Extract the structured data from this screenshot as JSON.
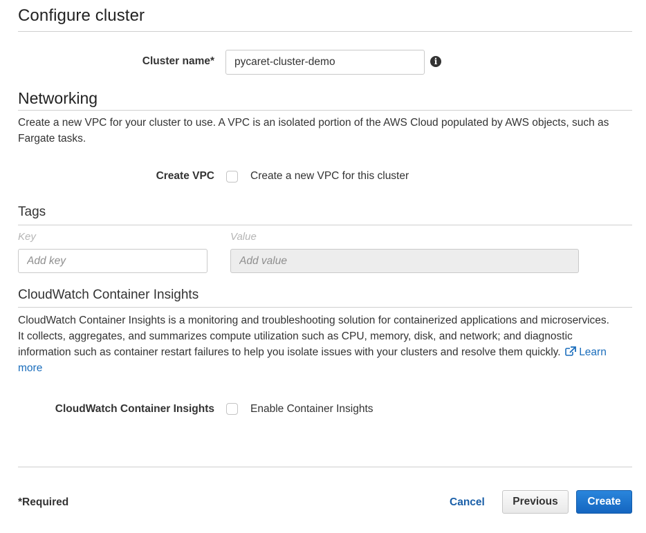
{
  "page": {
    "title": "Configure cluster"
  },
  "cluster_name": {
    "label": "Cluster name*",
    "value": "pycaret-cluster-demo",
    "info_icon": "info-icon"
  },
  "networking": {
    "heading": "Networking",
    "description": "Create a new VPC for your cluster to use. A VPC is an isolated portion of the AWS Cloud populated by AWS objects, such as Fargate tasks.",
    "create_vpc_label": "Create VPC",
    "create_vpc_checkbox_label": "Create a new VPC for this cluster",
    "create_vpc_checked": false
  },
  "tags": {
    "heading": "Tags",
    "key_column": "Key",
    "value_column": "Value",
    "key_placeholder": "Add key",
    "value_placeholder": "Add value"
  },
  "insights": {
    "heading": "CloudWatch Container Insights",
    "description_line1": "CloudWatch Container Insights is a monitoring and troubleshooting solution for containerized applications and microservices.",
    "description_line2": "It collects, aggregates, and summarizes compute utilization such as CPU, memory, disk, and network; and diagnostic",
    "description_line3": "information such as container restart failures to help you isolate issues with your clusters and resolve them quickly.",
    "learn_more_label_1": "Learn",
    "learn_more_label_2": "more",
    "link_icon": "external-link-icon",
    "field_label": "CloudWatch Container Insights",
    "checkbox_label": "Enable Container Insights",
    "checked": false
  },
  "footer": {
    "required_note": "*Required",
    "cancel_label": "Cancel",
    "previous_label": "Previous",
    "create_label": "Create"
  }
}
